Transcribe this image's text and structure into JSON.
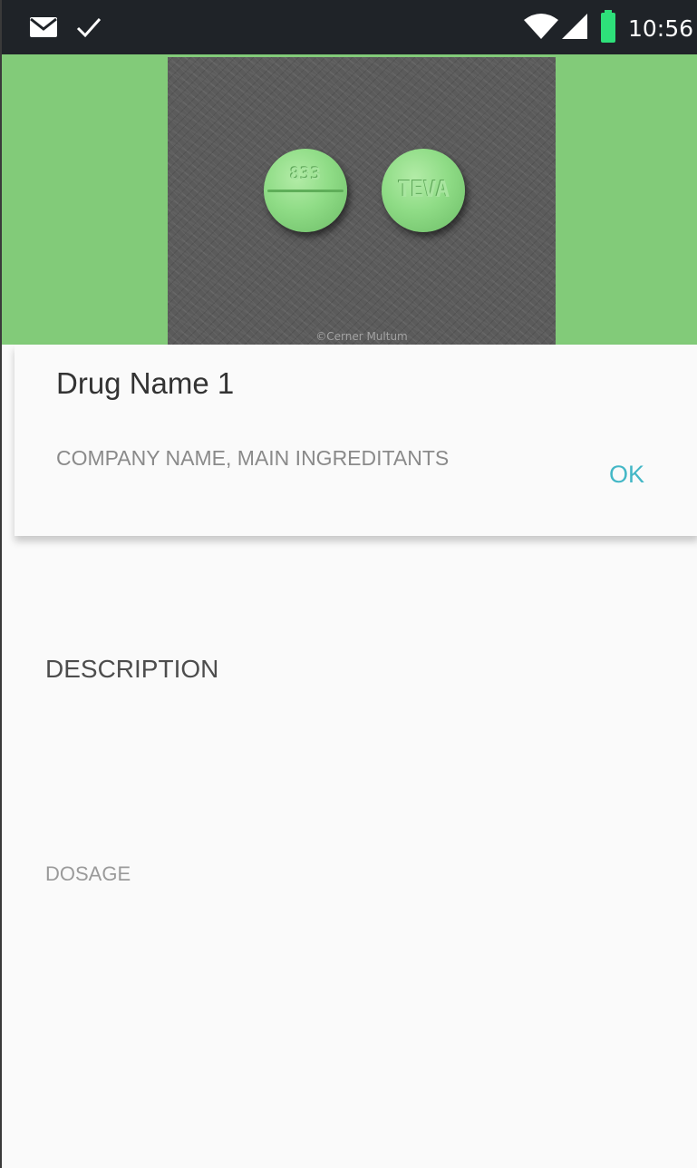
{
  "status_bar": {
    "time": "10:56",
    "icons": [
      "mail-icon",
      "check-icon",
      "wifi-icon",
      "signal-icon",
      "battery-icon"
    ],
    "battery_color": "#2ee07a"
  },
  "header": {
    "background_color": "#82cb79",
    "image": {
      "pill_left_imprint": "833",
      "pill_right_imprint": "TEVA",
      "watermark": "©Cerner Multum"
    }
  },
  "card": {
    "drug_name": "Drug Name 1",
    "subtitle": "COMPANY NAME, MAIN INGREDITANTS",
    "ok_label": "OK"
  },
  "details": {
    "description_label": "DESCRIPTION",
    "dosage_label": "DOSAGE"
  },
  "colors": {
    "accent": "#43b7c6",
    "status_bar": "#1f2328"
  }
}
